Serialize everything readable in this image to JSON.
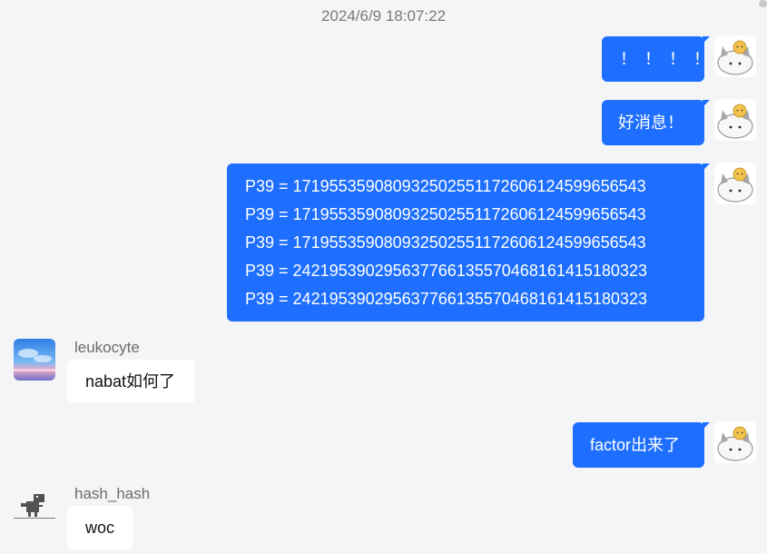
{
  "timestamp": "2024/6/9 18:07:22",
  "messages": {
    "m1": {
      "text": "！！！！"
    },
    "m2": {
      "text": "好消息！"
    },
    "m3": {
      "lines": [
        "P39 = 171955359080932502551172606124599656543",
        "P39 = 171955359080932502551172606124599656543",
        "P39 = 171955359080932502551172606124599656543",
        "P39 = 242195390295637766135570468161415180323",
        "P39 = 242195390295637766135570468161415180323"
      ]
    },
    "m4": {
      "text": "factor出来了"
    },
    "m5": {
      "sender": "leukocyte",
      "text": "nabat如何了"
    },
    "m6": {
      "sender": "hash_hash",
      "text": "woc"
    }
  },
  "colors": {
    "background": "#f4f5f7",
    "outgoing_bubble": "#1e6fff",
    "incoming_bubble": "#ffffff"
  },
  "icons": {
    "self_avatar": "cat-sticker-avatar",
    "leukocyte_avatar": "sky-sunset-avatar",
    "hash_hash_avatar": "dino-avatar"
  }
}
